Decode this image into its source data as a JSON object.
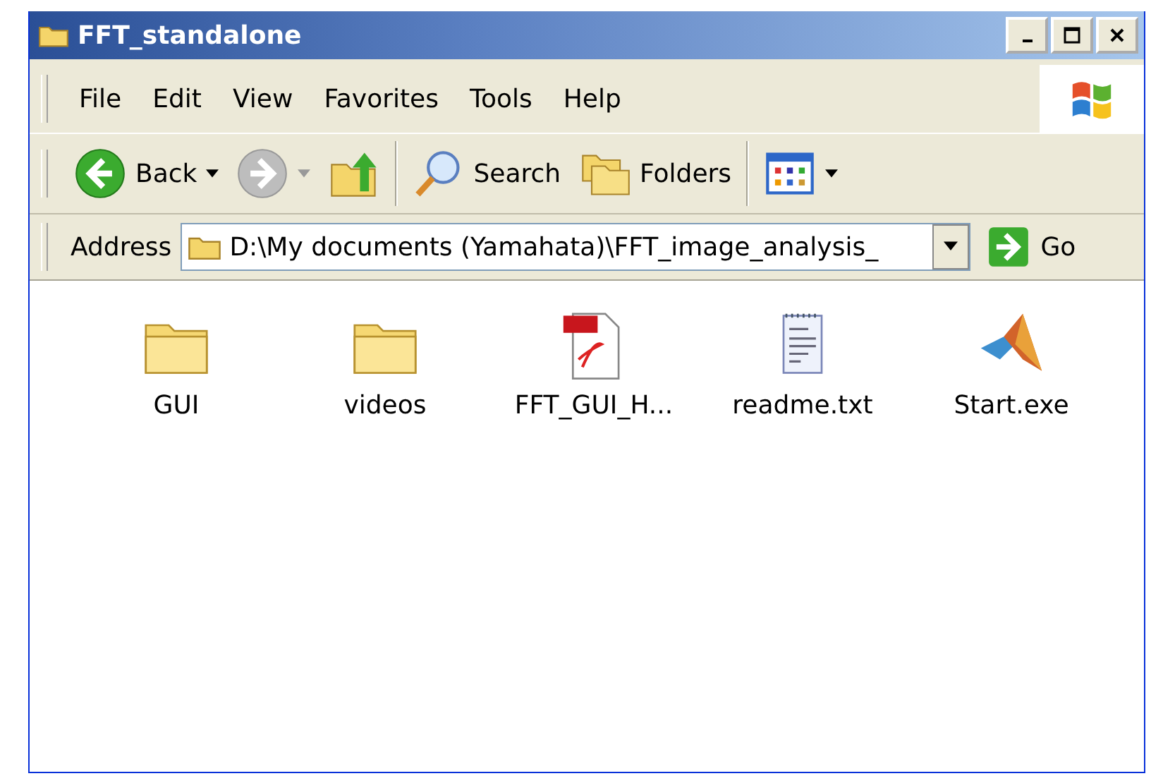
{
  "window": {
    "title": "FFT_standalone"
  },
  "menu": [
    "File",
    "Edit",
    "View",
    "Favorites",
    "Tools",
    "Help"
  ],
  "toolbar": [
    {
      "kind": "back",
      "label": "Back",
      "disabled": false
    },
    {
      "kind": "forward",
      "disabled": true
    },
    {
      "kind": "up",
      "disabled": false
    },
    {
      "kind": "search",
      "label": "Search",
      "disabled": false
    },
    {
      "kind": "folders",
      "label": "Folders",
      "disabled": false
    },
    {
      "kind": "views",
      "disabled": false
    }
  ],
  "address": {
    "label": "Address",
    "value": "D:\\My documents (Yamahata)\\FFT_image_analysis_",
    "go": "Go"
  },
  "files": [
    {
      "kind": "folder",
      "name": "GUI"
    },
    {
      "kind": "folder",
      "name": "videos"
    },
    {
      "kind": "pdf",
      "name": "FFT_GUI_H..."
    },
    {
      "kind": "text",
      "name": "readme.txt"
    },
    {
      "kind": "app",
      "name": "Start.exe"
    }
  ]
}
